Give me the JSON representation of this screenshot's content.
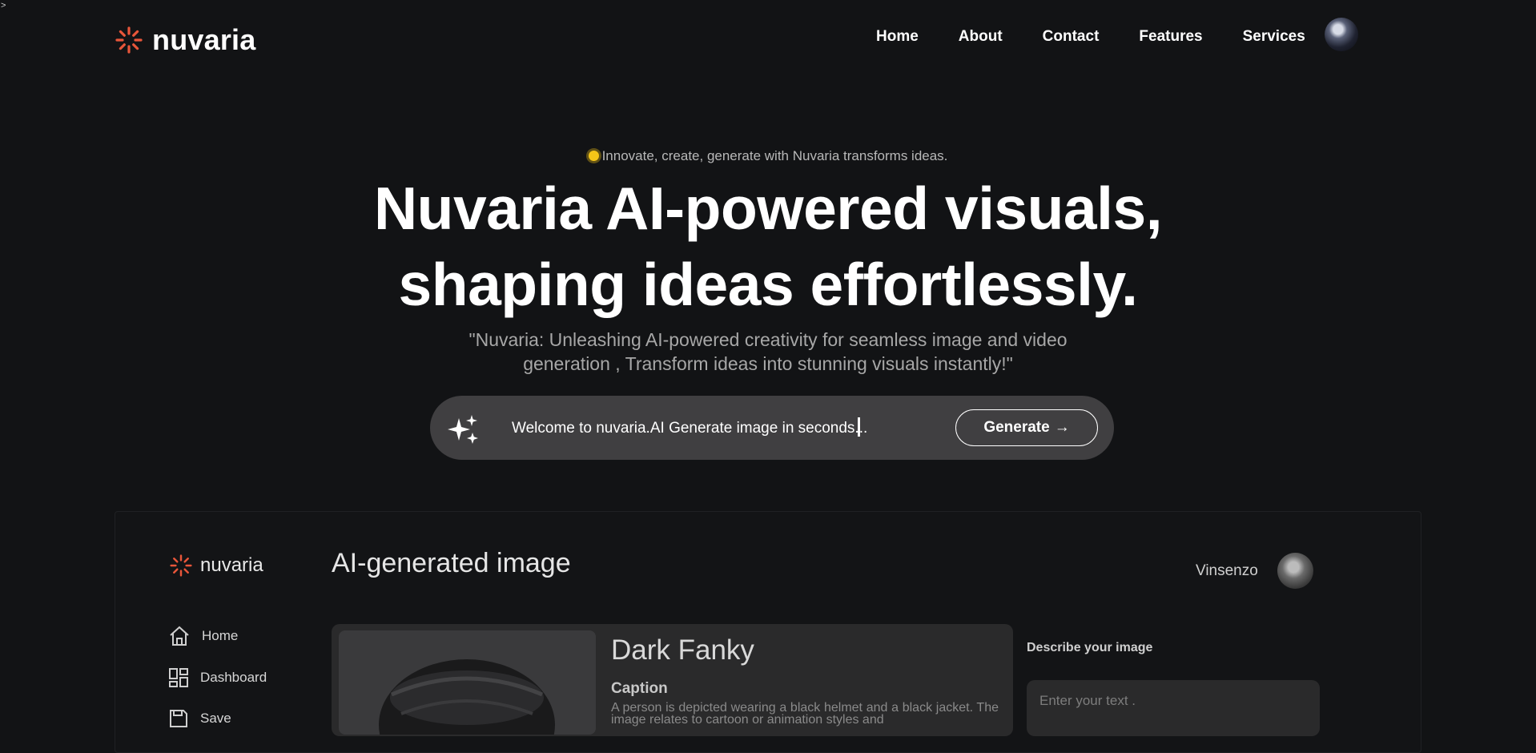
{
  "stray_char": ">",
  "brand": {
    "name": "nuvaria",
    "accent": "#e8563a"
  },
  "nav": {
    "items": [
      "Home",
      "About",
      "Contact",
      "Features",
      "Services"
    ]
  },
  "hero": {
    "tagline": "Innovate, create, generate with Nuvaria transforms ideas.",
    "headline_line1": "Nuvaria AI-powered visuals,",
    "headline_line2": "shaping ideas effortlessly.",
    "subtitle_line1": "\"Nuvaria: Unleashing AI-powered creativity for seamless image and video",
    "subtitle_line2": "generation , Transform ideas into stunning visuals instantly!\"",
    "prompt_placeholder": "Welcome to nuvaria.AI Generate image in seconds...",
    "generate_label": "Generate",
    "generate_arrow": "→"
  },
  "dashboard": {
    "brand": "nuvaria",
    "title": "AI-generated image",
    "user": "Vinsenzo",
    "sidebar": [
      {
        "label": "Home",
        "icon": "home-icon"
      },
      {
        "label": "Dashboard",
        "icon": "dashboard-icon"
      },
      {
        "label": "Save",
        "icon": "save-icon"
      }
    ],
    "card": {
      "title": "Dark Fanky",
      "caption_label": "Caption",
      "caption": "A person is depicted wearing a black helmet and a black jacket. The image relates to cartoon or animation styles and"
    },
    "describe_label": "Describe your image",
    "describe_placeholder": "Enter your text ."
  }
}
